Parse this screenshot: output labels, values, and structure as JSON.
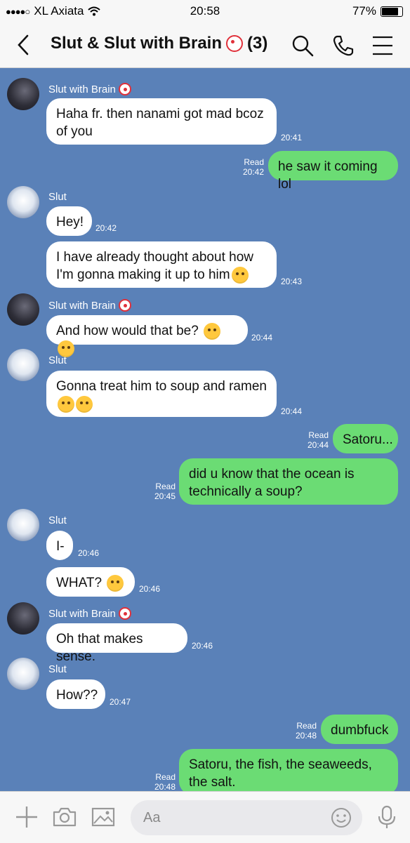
{
  "status": {
    "carrier": "XL Axiata",
    "time": "20:58",
    "battery": "77%",
    "battery_level": 0.77
  },
  "header": {
    "title": "Slut & Slut with Brain",
    "count": "(3)"
  },
  "senders": {
    "brain": "Slut with Brain",
    "slut": "Slut"
  },
  "messages": [
    {
      "text": "Haha fr. then nanami got mad bcoz of you",
      "time": "20:41"
    },
    {
      "text": "he saw it coming lol",
      "read": "Read",
      "time": "20:42"
    },
    {
      "text": "Hey!",
      "time": "20:42"
    },
    {
      "text": "I have already thought about how I'm gonna making it up to him",
      "time": "20:43"
    },
    {
      "text": "And how would that be?",
      "time": "20:44"
    },
    {
      "text": "Gonna treat him to soup and ramen",
      "time": "20:44"
    },
    {
      "text": "Satoru...",
      "read": "Read",
      "time": "20:44"
    },
    {
      "text": "did u know that the ocean is technically a soup?",
      "read": "Read",
      "time": "20:45"
    },
    {
      "text": "I-",
      "time": "20:46"
    },
    {
      "text": "WHAT?",
      "time": "20:46"
    },
    {
      "text": "Oh that makes sense.",
      "time": "20:46"
    },
    {
      "text": "How??",
      "time": "20:47"
    },
    {
      "text": "dumbfuck",
      "read": "Read",
      "time": "20:48"
    },
    {
      "text": "Satoru, the fish, the seaweeds, the salt.",
      "read": "Read",
      "time": "20:48"
    }
  ],
  "input": {
    "placeholder": "Aa"
  },
  "colors": {
    "chat_bg": "#5a81b8",
    "outgoing": "#6bdc74",
    "incoming": "#ffffff"
  }
}
